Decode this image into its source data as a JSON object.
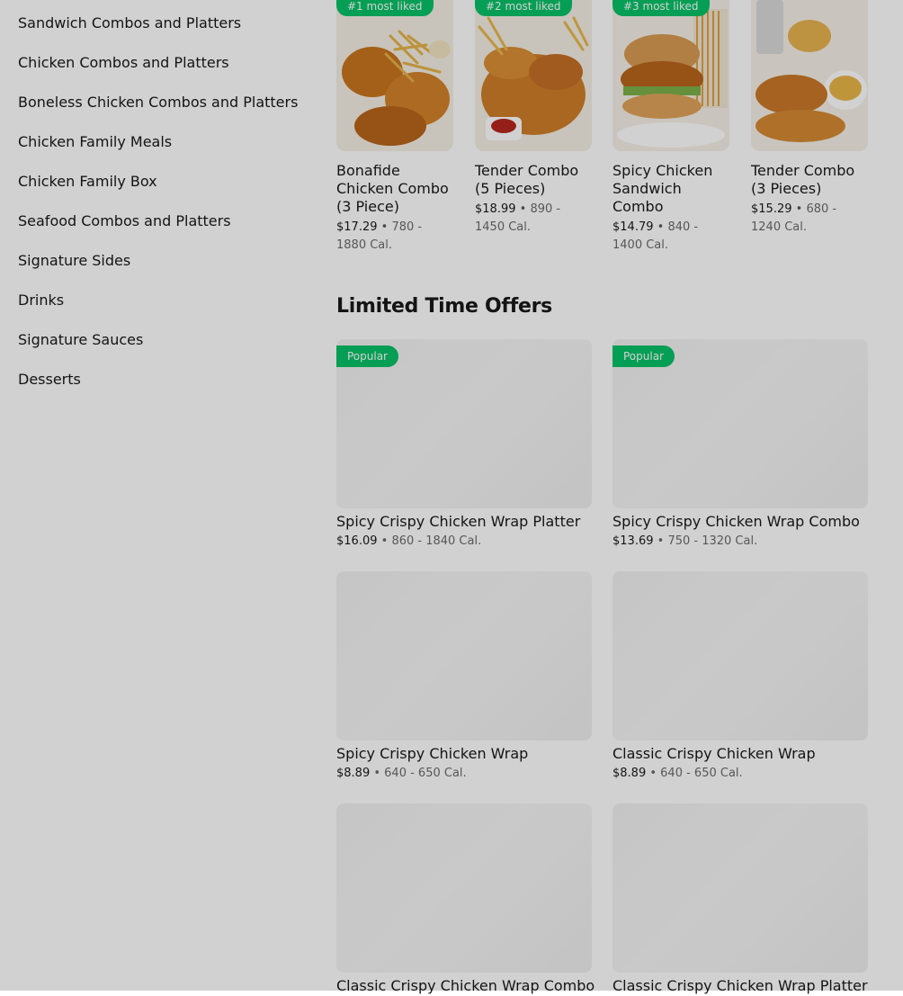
{
  "sidebar": {
    "items": [
      {
        "label": "Sandwich Combos and Platters"
      },
      {
        "label": "Chicken Combos and Platters"
      },
      {
        "label": "Boneless Chicken Combos and Platters"
      },
      {
        "label": "Chicken Family Meals"
      },
      {
        "label": "Chicken Family Box"
      },
      {
        "label": "Seafood Combos and Platters"
      },
      {
        "label": "Signature Sides"
      },
      {
        "label": "Drinks"
      },
      {
        "label": "Signature Sauces"
      },
      {
        "label": "Desserts"
      }
    ]
  },
  "most_liked": {
    "items": [
      {
        "badge": "#1 most liked",
        "title": "Bonafide Chicken Combo (3 Piece)",
        "price": "$17.29",
        "separator": " • ",
        "calories": "780 - 1880 Cal."
      },
      {
        "badge": "#2 most liked",
        "title": "Tender Combo (5 Pieces)",
        "price": "$18.99",
        "separator": " • ",
        "calories": "890 - 1450 Cal."
      },
      {
        "badge": "#3 most liked",
        "title": "Spicy Chicken Sandwich Combo",
        "price": "$14.79",
        "separator": " • ",
        "calories": "840 - 1400 Cal."
      },
      {
        "badge": "",
        "title": "Tender Combo (3 Pieces)",
        "price": "$15.29",
        "separator": " • ",
        "calories": "680 - 1240 Cal."
      }
    ]
  },
  "limited_time_offers": {
    "title": "Limited Time Offers",
    "items": [
      {
        "badge": "Popular",
        "title": "Spicy Crispy Chicken Wrap Platter",
        "price": "$16.09",
        "separator": " • ",
        "calories": "860 - 1840 Cal."
      },
      {
        "badge": "Popular",
        "title": "Spicy Crispy Chicken Wrap Combo",
        "price": "$13.69",
        "separator": " • ",
        "calories": "750 - 1320 Cal."
      },
      {
        "badge": "",
        "title": "Spicy Crispy Chicken Wrap",
        "price": "$8.89",
        "separator": " • ",
        "calories": "640 - 650 Cal."
      },
      {
        "badge": "",
        "title": "Classic Crispy Chicken Wrap",
        "price": "$8.89",
        "separator": " • ",
        "calories": "640 - 650 Cal."
      },
      {
        "badge": "",
        "title": "Classic Crispy Chicken Wrap Combo",
        "price": "",
        "separator": "",
        "calories": ""
      },
      {
        "badge": "",
        "title": "Classic Crispy Chicken Wrap Platter",
        "price": "",
        "separator": "",
        "calories": ""
      }
    ]
  },
  "colors": {
    "badge": "#06c167",
    "text": "#191919",
    "muted": "#6b6b6b"
  }
}
